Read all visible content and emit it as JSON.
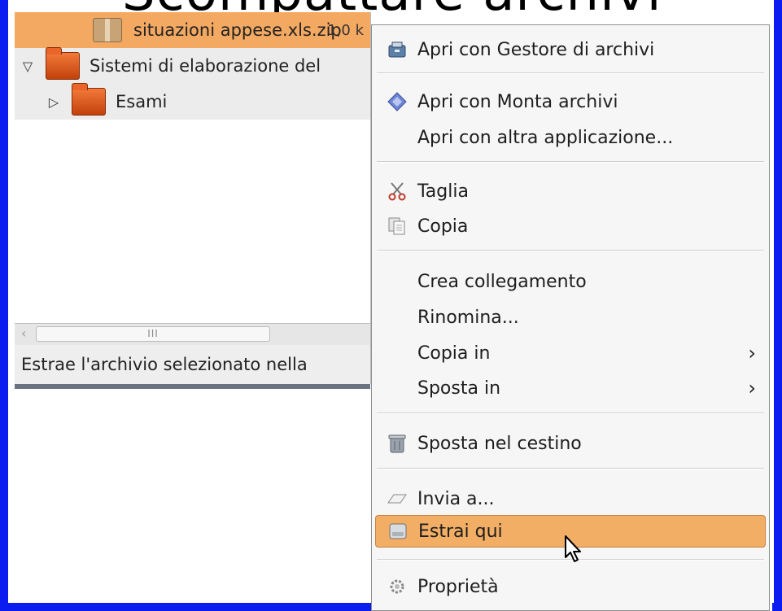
{
  "overlay_title": "Scompattare archivi",
  "file_manager": {
    "rows": [
      {
        "name": "situazioni appese.xls.zip",
        "size_fragment": "1,0 k",
        "type": "archive",
        "expander": ""
      },
      {
        "name": "Sistemi di elaborazione del",
        "type": "folder",
        "expander": "▽"
      },
      {
        "name": "Esami",
        "type": "folder",
        "expander": "▷"
      }
    ],
    "scroll_grip": "III",
    "scroll_left_arrow": "‹",
    "status_text": "Estrae l'archivio selezionato nella"
  },
  "context_menu": {
    "items": [
      {
        "label": "Apri con Gestore di archivi",
        "icon": "archive-manager-icon"
      },
      {
        "label": "Apri con Monta archivi",
        "icon": "mount-archive-icon"
      },
      {
        "label": "Apri con altra applicazione...",
        "icon": ""
      },
      {
        "label": "Taglia",
        "icon": "scissors-icon"
      },
      {
        "label": "Copia",
        "icon": "copy-icon"
      },
      {
        "label": "Crea collegamento",
        "icon": ""
      },
      {
        "label": "Rinomina...",
        "icon": ""
      },
      {
        "label": "Copia in",
        "icon": "",
        "submenu": "›"
      },
      {
        "label": "Sposta in",
        "icon": "",
        "submenu": "›"
      },
      {
        "label": "Sposta nel cestino",
        "icon": "trash-icon"
      },
      {
        "label": "Invia a...",
        "icon": "send-icon"
      },
      {
        "label": "Estrai qui",
        "icon": "extract-icon",
        "highlighted": true
      },
      {
        "label": "Proprietà",
        "icon": "gear-icon"
      }
    ]
  },
  "colors": {
    "frame": "#0a1cf0",
    "selection": "#f3a962",
    "menu_highlight": "#f3ae66",
    "folder": "#e9652a"
  }
}
